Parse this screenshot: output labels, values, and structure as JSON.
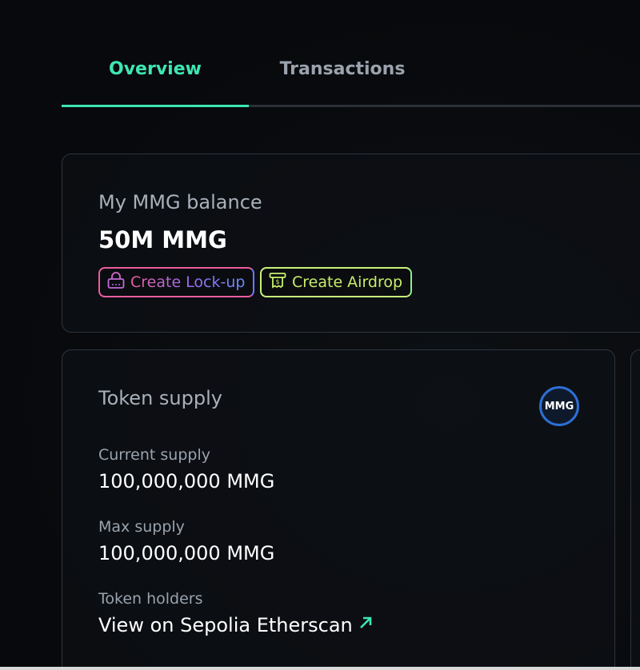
{
  "tabs": [
    {
      "label": "Overview",
      "active": true
    },
    {
      "label": "Transactions",
      "active": false
    }
  ],
  "balance": {
    "title": "My MMG balance",
    "value": "50M MMG",
    "lockup_label": "Create Lock-up",
    "airdrop_label": "Create Airdrop"
  },
  "supply": {
    "title": "Token supply",
    "logo_text": "MMG",
    "current_label": "Current supply",
    "current_value": "100,000,000 MMG",
    "max_label": "Max supply",
    "max_value": "100,000,000 MMG",
    "holders_label": "Token holders",
    "etherscan_label": "View on Sepolia Etherscan"
  },
  "colors": {
    "accent": "#3ee6b1",
    "background": "#0b0c10",
    "lockup": "#e85d9e",
    "airdrop": "#c6f26e"
  },
  "icons": {
    "lockup": "lock-icon",
    "airdrop": "airdrop-ticket-icon",
    "external": "arrow-up-right-icon"
  }
}
